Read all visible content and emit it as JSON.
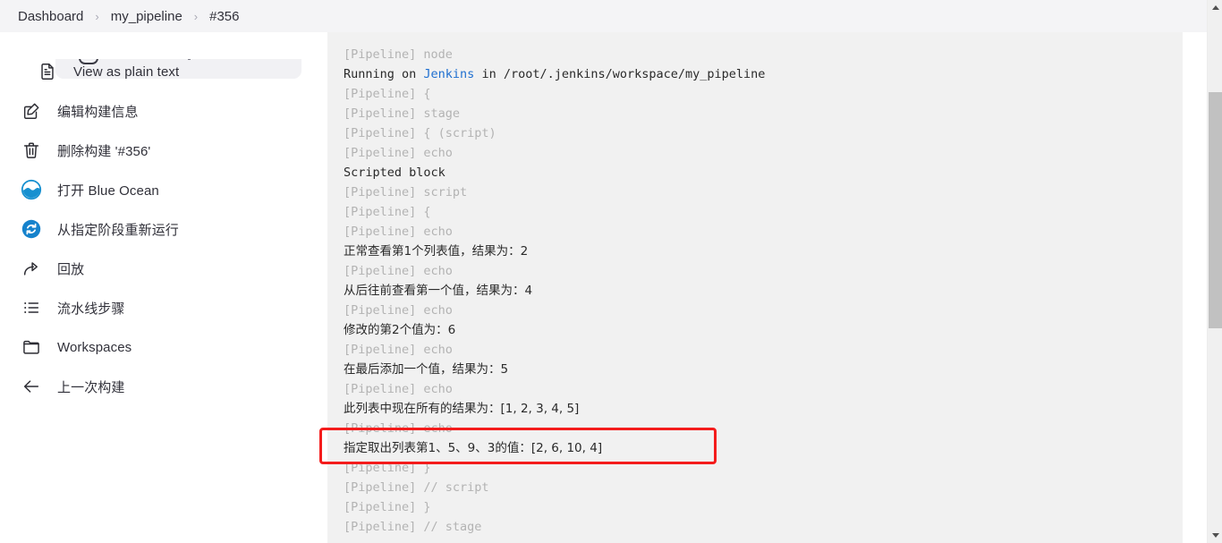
{
  "breadcrumb": {
    "separator": "›",
    "items": [
      {
        "label": "Dashboard"
      },
      {
        "label": "my_pipeline"
      },
      {
        "label": "#356"
      }
    ]
  },
  "sidebar": {
    "items": [
      {
        "label": "View as plain text",
        "icon": "document-text-icon",
        "indented": true
      },
      {
        "label": "编辑构建信息",
        "icon": "edit-square-icon",
        "indented": false
      },
      {
        "label": "删除构建 '#356'",
        "icon": "trash-icon",
        "indented": false
      },
      {
        "label": "打开 Blue Ocean",
        "icon": "blue-ocean-icon",
        "indented": false
      },
      {
        "label": "从指定阶段重新运行",
        "icon": "replay-stage-icon",
        "indented": false
      },
      {
        "label": "回放",
        "icon": "share-arrow-icon",
        "indented": false
      },
      {
        "label": "流水线步骤",
        "icon": "list-steps-icon",
        "indented": false
      },
      {
        "label": "Workspaces",
        "icon": "folder-icon",
        "indented": false
      },
      {
        "label": "上一次构建",
        "icon": "arrow-left-icon",
        "indented": false
      }
    ]
  },
  "console": {
    "lines": [
      {
        "text": "[Pipeline] node",
        "type": "meta"
      },
      {
        "type": "link-line",
        "pre": "Running on ",
        "link": "Jenkins",
        "post": " in /root/.jenkins/workspace/my_pipeline"
      },
      {
        "text": "[Pipeline] {",
        "type": "meta"
      },
      {
        "text": "[Pipeline] stage",
        "type": "meta"
      },
      {
        "text": "[Pipeline] { (script)",
        "type": "meta"
      },
      {
        "text": "[Pipeline] echo",
        "type": "meta"
      },
      {
        "text": "Scripted block",
        "type": "out"
      },
      {
        "text": "[Pipeline] script",
        "type": "meta"
      },
      {
        "text": "[Pipeline] {",
        "type": "meta"
      },
      {
        "text": "[Pipeline] echo",
        "type": "meta"
      },
      {
        "text": "正常查看第1个列表值，结果为：2",
        "type": "out-cjk"
      },
      {
        "text": "[Pipeline] echo",
        "type": "meta"
      },
      {
        "text": "从后往前查看第一个值，结果为：4",
        "type": "out-cjk"
      },
      {
        "text": "[Pipeline] echo",
        "type": "meta"
      },
      {
        "text": "修改的第2个值为：6",
        "type": "out-cjk"
      },
      {
        "text": "[Pipeline] echo",
        "type": "meta"
      },
      {
        "text": "在最后添加一个值，结果为：5",
        "type": "out-cjk"
      },
      {
        "text": "[Pipeline] echo",
        "type": "meta"
      },
      {
        "text": "此列表中现在所有的结果为：[1, 2, 3, 4, 5]",
        "type": "out-cjk"
      },
      {
        "text": "[Pipeline] echo",
        "type": "meta"
      },
      {
        "text": "指定取出列表第1、5、9、3的值：[2, 6, 10, 4]",
        "type": "out-cjk"
      },
      {
        "text": "[Pipeline] }",
        "type": "meta"
      },
      {
        "text": "[Pipeline] // script",
        "type": "meta"
      },
      {
        "text": "[Pipeline] }",
        "type": "meta"
      },
      {
        "text": "[Pipeline] // stage",
        "type": "meta"
      }
    ]
  },
  "annotation": {
    "color": "#f41c1c",
    "target_line": "指定取出列表第1、5、9、3的值：[2, 6, 10, 4]"
  },
  "colors": {
    "link": "#1f6fd0",
    "meta_text": "#b3b3b3",
    "output_text": "#2a2a2a",
    "console_bg": "#f1f1f1",
    "header_bg": "#f4f4f6",
    "accent_blue": "#1e88d6"
  }
}
